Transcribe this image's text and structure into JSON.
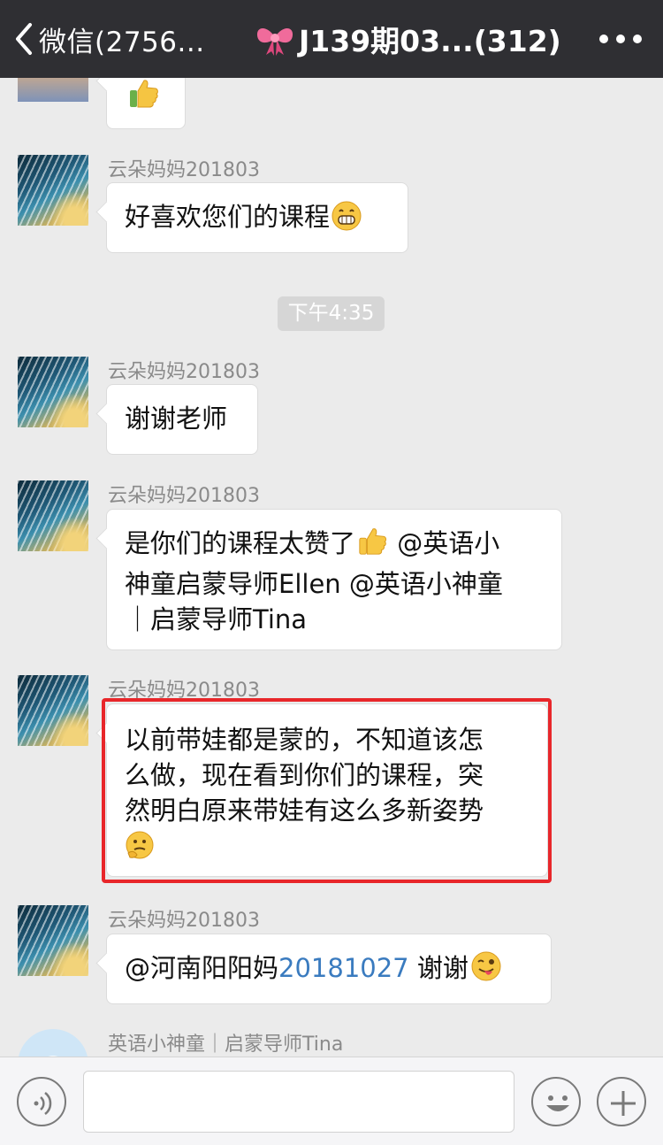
{
  "navbar": {
    "back_label": "微信(2756...",
    "title": "J139期03...(312)",
    "title_icon": "ribbon-bow-emoji"
  },
  "timestamp": "下午4:35",
  "messages": [
    {
      "sender": "",
      "text": "",
      "emoji": "thumbs-up"
    },
    {
      "sender": "云朵妈妈201803",
      "text": "好喜欢您们的课程",
      "emoji": "grinning-face"
    },
    {
      "sender": "云朵妈妈201803",
      "text": "谢谢老师"
    },
    {
      "sender": "云朵妈妈201803",
      "lines": [
        "是你们的课程太赞了",
        "神童启蒙导师Ellen @英语小神童",
        "｜启蒙导师Tina"
      ],
      "line1_suffix": " @英语小",
      "emoji": "thumbs-up"
    },
    {
      "sender": "云朵妈妈201803",
      "lines": [
        "以前带娃都是蒙的，不知道该怎",
        "么做，现在看到你们的课程，突",
        "然明白原来带娃有这么多新姿势"
      ],
      "emoji": "thinking-face"
    },
    {
      "sender": "云朵妈妈201803",
      "text_prefix": "@河南阳阳妈",
      "text_number": "20181027",
      "text_suffix": " 谢谢",
      "emoji": "winking-face-tongue"
    },
    {
      "sender": "英语小神童｜启蒙导师Tina"
    }
  ],
  "input": {
    "value": "",
    "placeholder": ""
  },
  "colors": {
    "navbar_bg": "#2f2f33",
    "chat_bg": "#ebebeb",
    "highlight": "#e8262a",
    "mention_number": "#3a7bbf"
  }
}
